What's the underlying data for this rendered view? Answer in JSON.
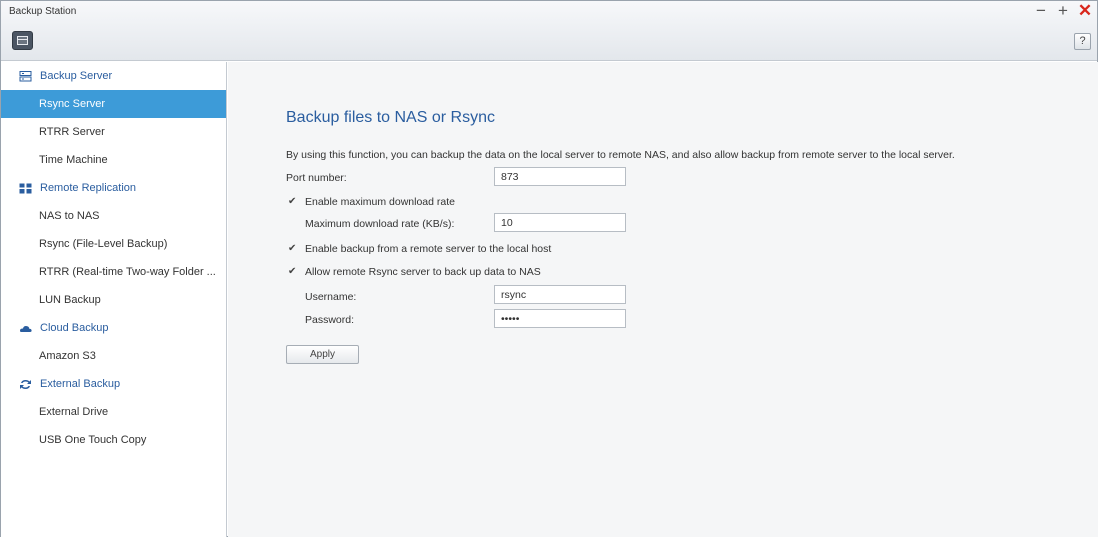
{
  "window": {
    "title": "Backup Station",
    "minimize_glyph": "−",
    "maximize_glyph": "+",
    "close_glyph": "✕",
    "help_label": "?"
  },
  "sidebar": {
    "groups": [
      {
        "label": "Backup Server",
        "icon": "server-icon",
        "items": [
          "Rsync Server",
          "RTRR Server",
          "Time Machine"
        ]
      },
      {
        "label": "Remote Replication",
        "icon": "replication-icon",
        "items": [
          "NAS to NAS",
          "Rsync (File-Level Backup)",
          "RTRR (Real-time Two-way Folder ...",
          "LUN Backup"
        ]
      },
      {
        "label": "Cloud Backup",
        "icon": "cloud-icon",
        "items": [
          "Amazon S3"
        ]
      },
      {
        "label": "External Backup",
        "icon": "sync-arrows-icon",
        "items": [
          "External Drive",
          "USB One Touch Copy"
        ]
      }
    ],
    "active_item": "Rsync Server"
  },
  "main": {
    "title": "Backup files to NAS or Rsync",
    "description": "By using this function, you can backup the data on the local server to remote NAS, and also allow backup from remote server to the local server.",
    "port_label": "Port number:",
    "port_value": "873",
    "enable_max_rate_label": "Enable maximum download rate",
    "enable_max_rate_checked": true,
    "max_rate_label": "Maximum download rate (KB/s):",
    "max_rate_value": "10",
    "enable_remote_backup_label": "Enable backup from a remote server to the local host",
    "enable_remote_backup_checked": true,
    "allow_rsync_label": "Allow remote Rsync server to back up data to NAS",
    "allow_rsync_checked": true,
    "username_label": "Username:",
    "username_value": "rsync",
    "password_label": "Password:",
    "password_value": "•••••",
    "apply_label": "Apply"
  },
  "colors": {
    "accent": "#3d9bd8",
    "heading": "#2a5d9f",
    "close": "#d9261c"
  }
}
